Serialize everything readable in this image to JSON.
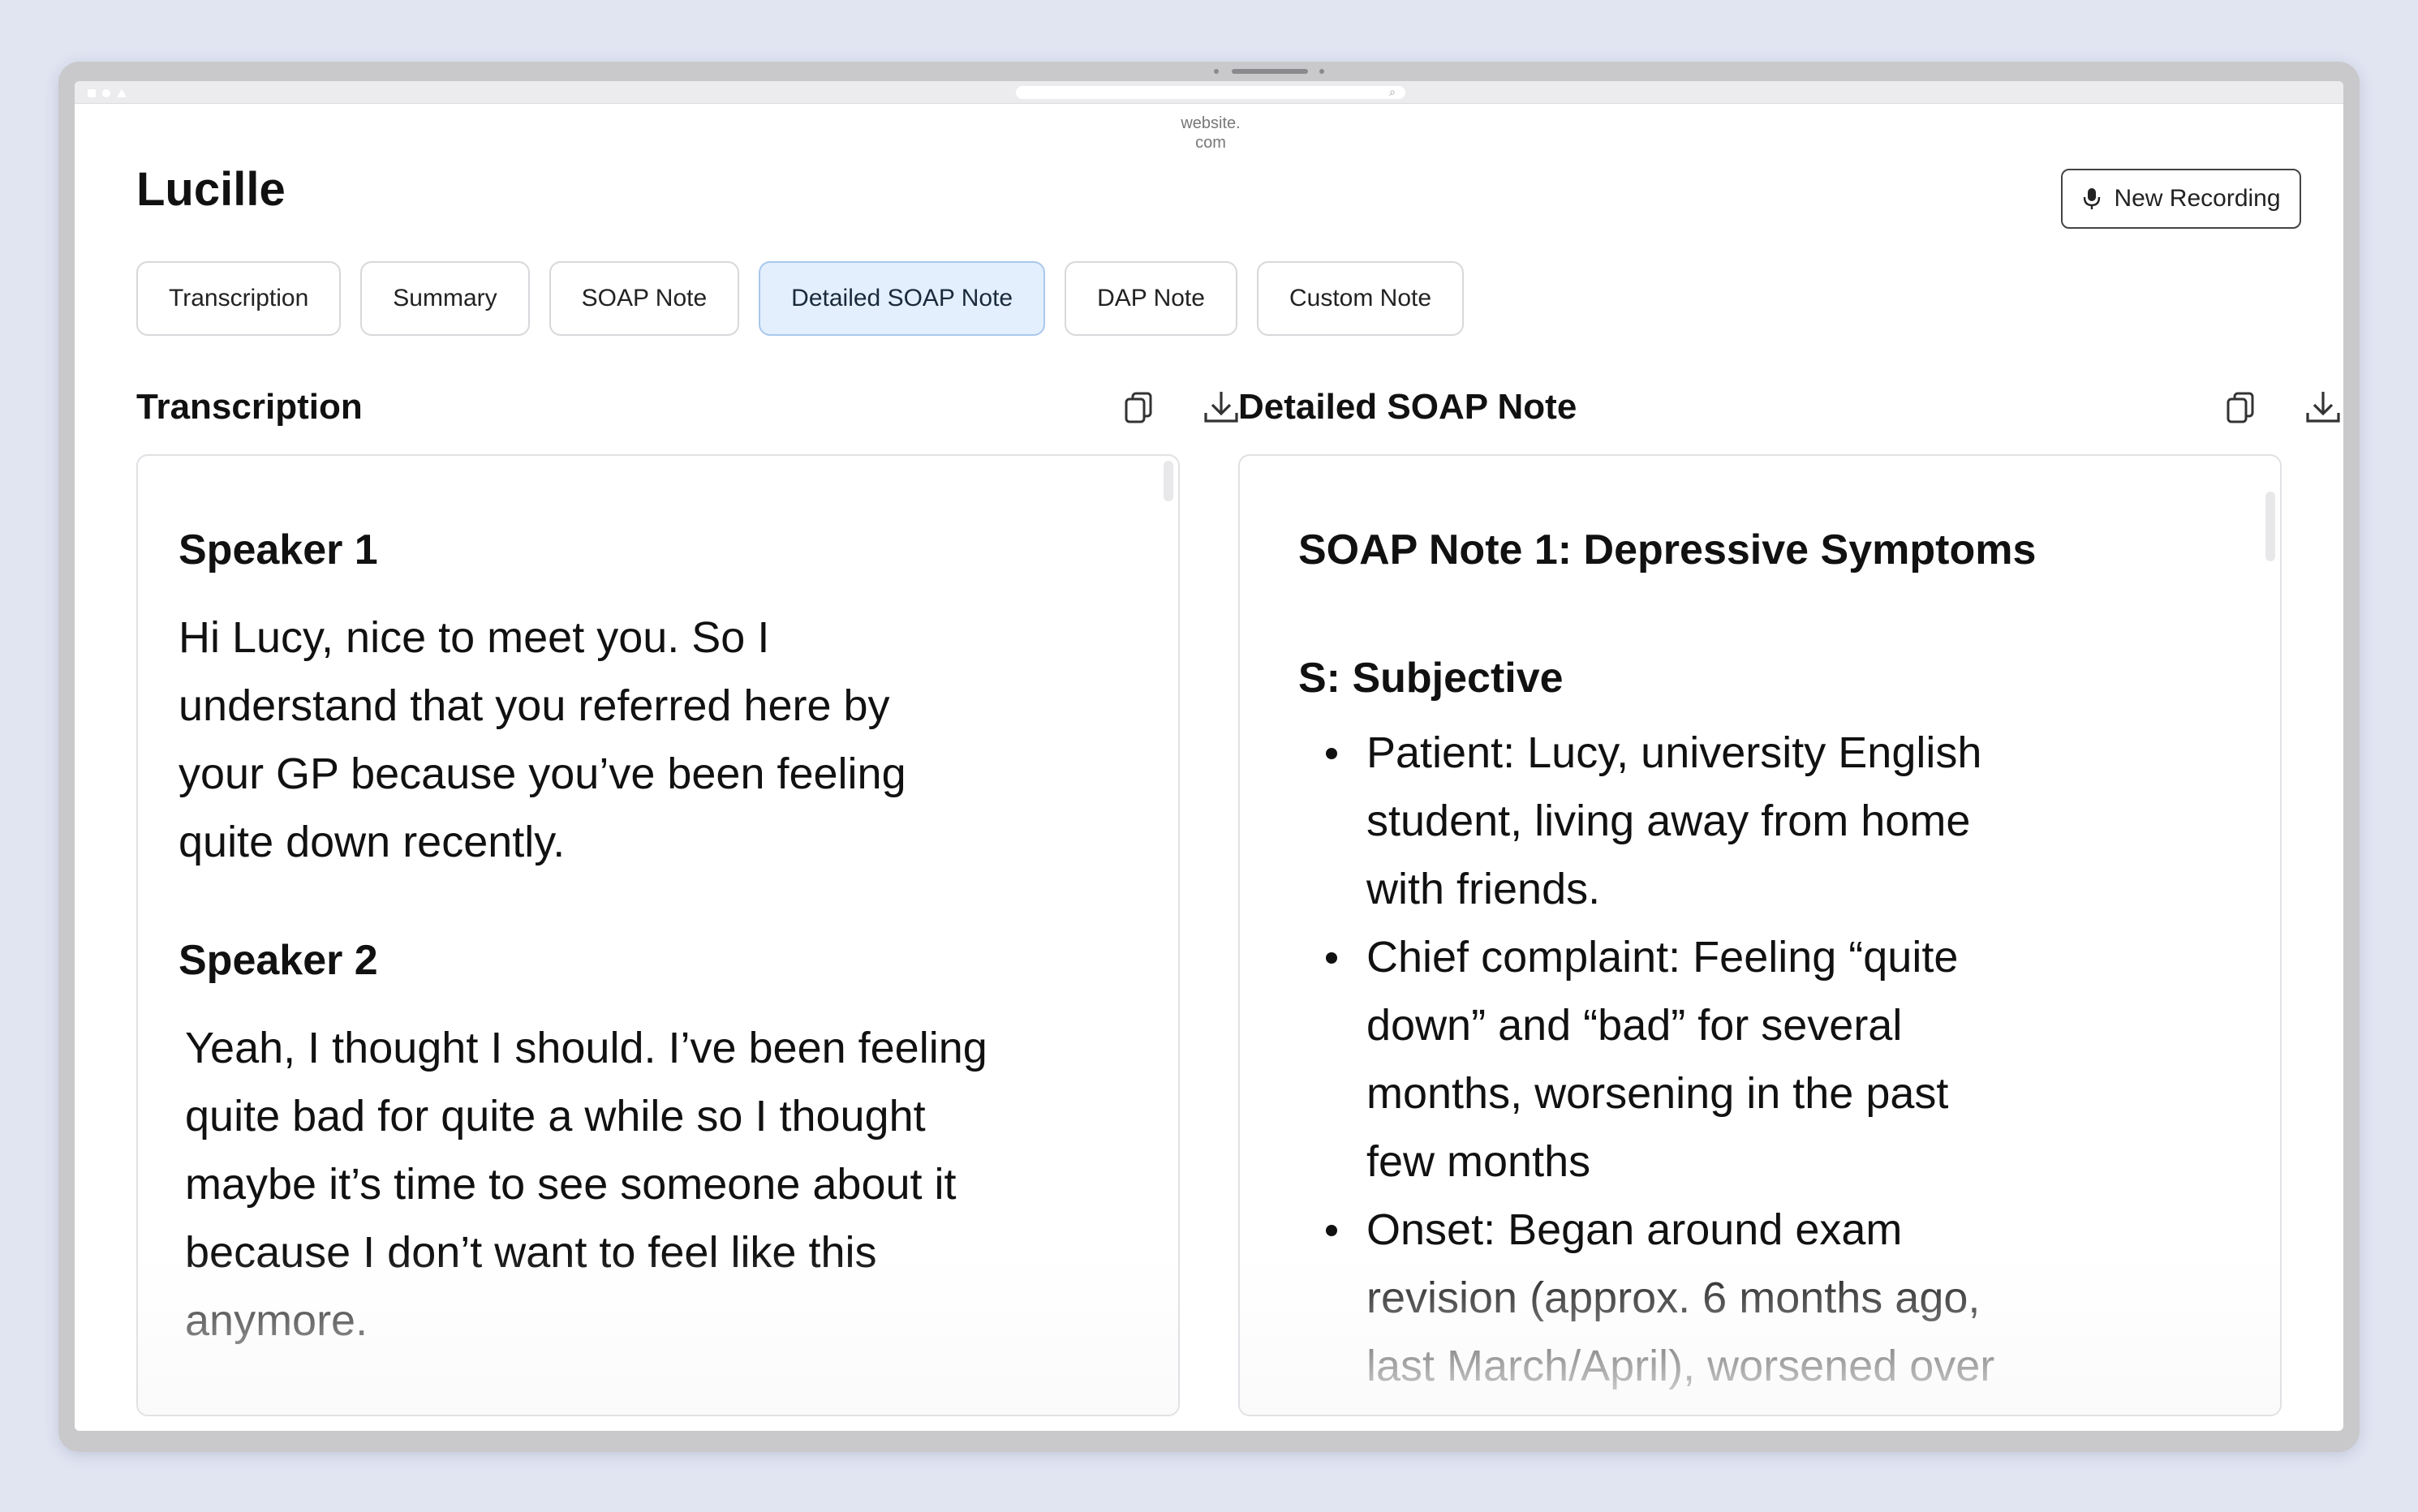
{
  "browser": {
    "url": "website.\ncom"
  },
  "header": {
    "title": "Lucille",
    "new_recording_label": "New Recording"
  },
  "tabs": [
    {
      "label": "Transcription",
      "active": false
    },
    {
      "label": "Summary",
      "active": false
    },
    {
      "label": "SOAP Note",
      "active": false
    },
    {
      "label": "Detailed SOAP Note",
      "active": true
    },
    {
      "label": "DAP Note",
      "active": false
    },
    {
      "label": "Custom Note",
      "active": false
    }
  ],
  "transcription": {
    "title": "Transcription",
    "entries": [
      {
        "speaker": "Speaker 1",
        "lines": [
          "Hi Lucy, nice to meet you. So I",
          "understand that you referred here by",
          "your GP because you’ve been feeling",
          "quite down recently."
        ]
      },
      {
        "speaker": "Speaker 2",
        "lines": [
          "Yeah, I thought I should. I’ve been feeling",
          "quite bad for quite a while so I thought",
          "maybe it’s time to see someone about it",
          "because I don’t want to feel like this",
          "anymore."
        ]
      }
    ]
  },
  "note": {
    "title": "Detailed SOAP Note",
    "heading": "SOAP Note 1: Depressive Symptoms",
    "section": "S: Subjective",
    "bullets": [
      [
        "Patient: Lucy, university English",
        "student, living away from home",
        "with friends."
      ],
      [
        "Chief complaint: Feeling “quite",
        "down” and “bad” for several",
        "months, worsening in the past",
        "few months"
      ],
      [
        "Onset: Began around exam",
        "revision (approx. 6 months ago,",
        "last March/April), worsened over"
      ]
    ]
  },
  "icons": {
    "copy": "copy-icon",
    "download": "download-icon",
    "microphone": "microphone-icon"
  },
  "colors": {
    "background": "#e1e5f2",
    "active_tab_bg": "#e3effd",
    "active_tab_border": "#a9c8ec"
  }
}
